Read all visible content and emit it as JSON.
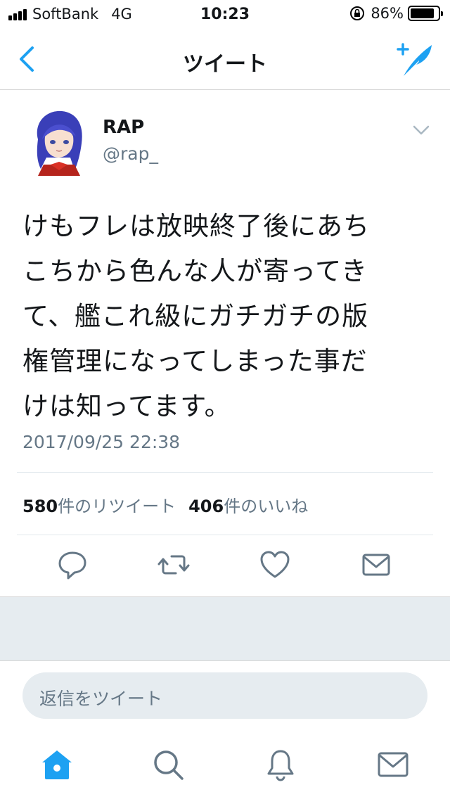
{
  "status_bar": {
    "carrier": "SoftBank",
    "network": "4G",
    "time": "10:23",
    "battery": "86%",
    "battery_level": 0.86
  },
  "nav": {
    "title": "ツイート",
    "back_icon": "chevron-left-icon",
    "compose_icon": "compose-tweet-icon"
  },
  "tweet": {
    "author_name": "RAP",
    "author_handle": "@rap_",
    "text_lines": [
      "けもフレは放映終了後にあち",
      "こちから色んな人が寄ってき",
      "て、艦これ級にガチガチの版",
      "権管理になってしまった事だ",
      "けは知ってます。"
    ],
    "timestamp": "2017/09/25 22:38",
    "retweet_count": "580",
    "retweet_label": "件のリツイート",
    "like_count": "406",
    "like_label": "件のいいね"
  },
  "reply": {
    "placeholder": "返信をツイート"
  },
  "tabbar": {
    "items": [
      "home-icon",
      "search-icon",
      "notifications-icon",
      "messages-icon"
    ]
  },
  "colors": {
    "accent": "#1da1f2",
    "text_secondary": "#657786",
    "icon_gray": "#657786",
    "divider": "#e1e8ed",
    "band": "#e6ecf0"
  }
}
